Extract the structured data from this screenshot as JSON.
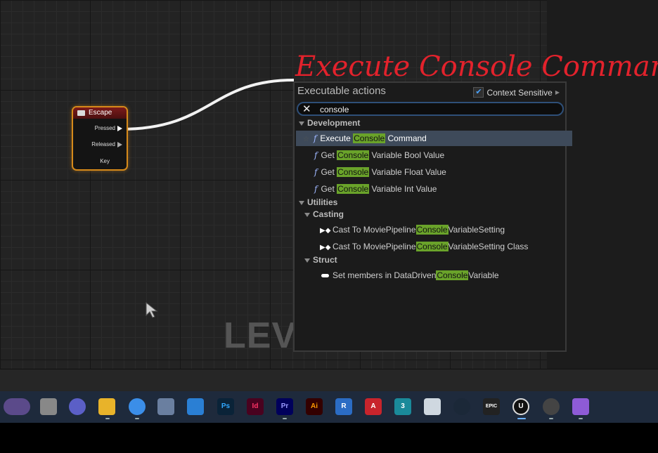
{
  "annotation": {
    "text": "Execute Console Command",
    "color": "#e3222c"
  },
  "graph": {
    "watermark": "LEV",
    "node": {
      "title": "Escape",
      "pins": {
        "pressed": "Pressed",
        "released": "Released",
        "key": "Key"
      }
    }
  },
  "menu": {
    "title": "Executable actions",
    "context_sensitive": {
      "label": "Context Sensitive",
      "checked": true
    },
    "search": {
      "value": "console",
      "clear_icon": "close-icon"
    },
    "highlight_color": "#6aa32a",
    "categories": {
      "development": "Development",
      "utilities": "Utilities",
      "casting": "Casting",
      "struct": "Struct"
    },
    "items": [
      {
        "pre": "Execute ",
        "match": "Console",
        "post": " Command",
        "selected": true
      },
      {
        "pre": "Get ",
        "match": "Console",
        "post": " Variable Bool Value"
      },
      {
        "pre": "Get ",
        "match": "Console",
        "post": " Variable Float Value"
      },
      {
        "pre": "Get ",
        "match": "Console",
        "post": " Variable Int Value"
      },
      {
        "pre": "Cast To MoviePipeline",
        "match": "Console",
        "post": "VariableSetting"
      },
      {
        "pre": "Cast To MoviePipeline",
        "match": "Console",
        "post": "VariableSetting Class"
      },
      {
        "pre": "Set members in DataDriven",
        "match": "Console",
        "post": "Variable"
      }
    ]
  },
  "taskbar": {
    "apps": [
      {
        "icon": "widgets-icon",
        "label": ""
      },
      {
        "icon": "task-view-icon",
        "label": ""
      },
      {
        "icon": "teams-icon",
        "label": ""
      },
      {
        "icon": "file-explorer-icon",
        "label": ""
      },
      {
        "icon": "chrome-icon",
        "label": ""
      },
      {
        "icon": "store-icon",
        "label": ""
      },
      {
        "icon": "mail-icon",
        "label": ""
      },
      {
        "icon": "photoshop-icon",
        "label": "Ps"
      },
      {
        "icon": "indesign-icon",
        "label": "Id"
      },
      {
        "icon": "premiere-icon",
        "label": "Pr"
      },
      {
        "icon": "illustrator-icon",
        "label": "Ai"
      },
      {
        "icon": "revit-icon",
        "label": "R"
      },
      {
        "icon": "autocad-icon",
        "label": "A"
      },
      {
        "icon": "3dsmax-icon",
        "label": "3"
      },
      {
        "icon": "cube-app-icon",
        "label": ""
      },
      {
        "icon": "steam-icon",
        "label": ""
      },
      {
        "icon": "epic-games-icon",
        "label": "EPIC"
      },
      {
        "icon": "unreal-engine-icon",
        "label": "U"
      },
      {
        "icon": "davinci-icon",
        "label": ""
      },
      {
        "icon": "visual-studio-icon",
        "label": ""
      }
    ]
  }
}
